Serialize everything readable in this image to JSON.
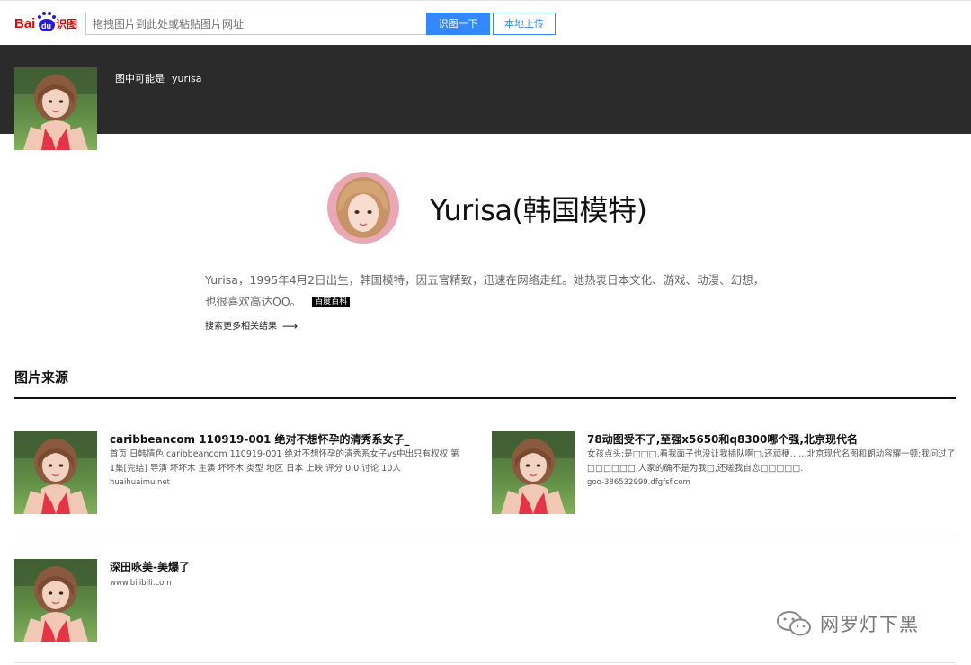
{
  "header": {
    "logo_text": "Bai",
    "logo_du": "du",
    "logo_suffix": "识图",
    "search_placeholder": "拖拽图片到此处或粘贴图片网址",
    "search_button": "识图一下",
    "upload_button": "本地上传"
  },
  "guess": {
    "prefix": "图中可能是",
    "name": "yurisa"
  },
  "person": {
    "title": "Yurisa(韩国模特)",
    "description": "Yurisa，1995年4月2日出生，韩国模特，因五官精致，迅速在网络走红。她热衷日本文化、游戏、动漫、幻想，也很喜欢高达OO。",
    "badge": "百度百科",
    "more_link": "搜索更多相关结果"
  },
  "section": {
    "title": "图片来源"
  },
  "results": [
    {
      "title": "caribbeancom 110919-001 绝对不想怀孕的清秀系女子_",
      "snippet": "首页 日韩情色 caribbeancom 110919-001 绝对不想怀孕的清秀系女子vs中出只有权权 第1集[完结] 导演 坏坏木 主演 坏坏木 类型 地区 日本 上映 评分 0.0 讨论 10人",
      "source": "huaihuaimu.net"
    },
    {
      "title": "78动图受不了,至强x5650和q8300哪个强,北京现代名",
      "snippet": "女孩点头:是□□□,看我面子也没让我插队啊□,还顽梗……北京现代名图和朗动容耀一顿:我问过了□□□□□□,人家的确不是为我□,还嗟我自恋□□□□□.",
      "source": "goo-386532999.dfgfsf.com"
    },
    {
      "title": "深田咏美-美爆了",
      "snippet": "",
      "source": "www.bilibili.com"
    }
  ],
  "watermark": {
    "text": "网罗灯下黑"
  },
  "colors": {
    "accent": "#3388ff",
    "dark_band": "#2b2b2b",
    "logo_red": "#e10602",
    "logo_blue": "#2319dc"
  }
}
